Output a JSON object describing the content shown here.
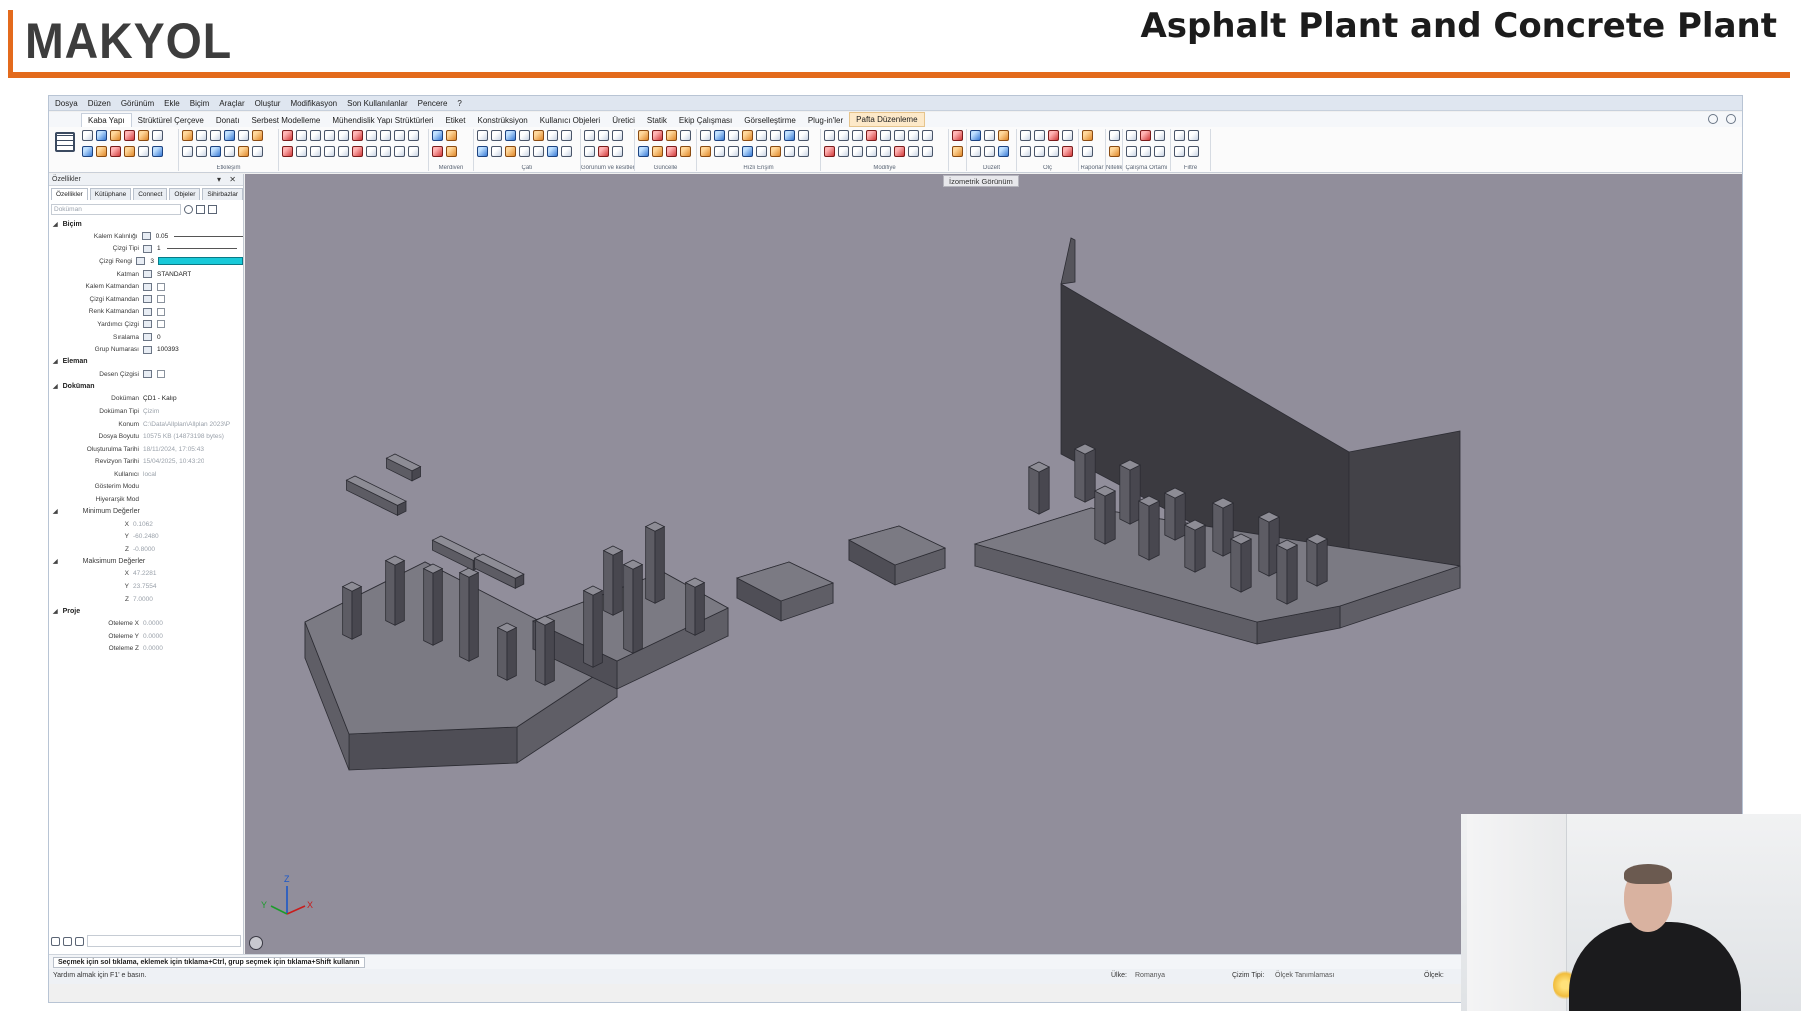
{
  "slide": {
    "logo_text": "MAKYOL",
    "title": "Asphalt Plant and Concrete Plant",
    "accent_color": "#e36a1c"
  },
  "menu": [
    "Dosya",
    "Düzen",
    "Görünüm",
    "Ekle",
    "Biçim",
    "Araçlar",
    "Oluştur",
    "Modifikasyon",
    "Son Kullanılanlar",
    "Pencere",
    "?"
  ],
  "tabs": [
    "Kaba Yapı",
    "Strüktürel Çerçeve",
    "Donatı",
    "Serbest Modelleme",
    "Mühendislik Yapı Strüktürleri",
    "Etiket",
    "Konstrüksiyon",
    "Kullanıcı Objeleri",
    "Üretici",
    "Statik",
    "Ekip Çalışması",
    "Görselleştirme",
    "Plug-in'ler",
    "Pafta Düzenleme"
  ],
  "ribbon_groups": [
    "Etkileşim",
    "Merdiven",
    "Çatı",
    "Görünüm ve kesitler",
    "Güncelle",
    "Hızlı Erişim",
    "Modifiye",
    "Düzelt",
    "Ölç",
    "Raporlar",
    "Nitelikler",
    "Filtre",
    "Çalışma Ortamı"
  ],
  "properties_panel": {
    "title": "Özellikler",
    "tabs": [
      "Özellikler",
      "Kütüphane",
      "Connect",
      "Objeler",
      "Sihirbazlar"
    ],
    "search_placeholder": "Doküman",
    "sections": {
      "bicim": "Biçim",
      "eleman": "Eleman",
      "dokuman": "Doküman",
      "proje": "Proje"
    },
    "bicim_rows": [
      {
        "key": "Kalem Kalınlığı",
        "value": "0.05"
      },
      {
        "key": "Çizgi Tipi",
        "value": "1"
      },
      {
        "key": "Çizgi Rengi",
        "value": "3"
      },
      {
        "key": "Katman",
        "value": "STANDART"
      },
      {
        "key": "Kalem Katmandan",
        "value": ""
      },
      {
        "key": "Çizgi Katmandan",
        "value": ""
      },
      {
        "key": "Renk Katmandan",
        "value": ""
      },
      {
        "key": "Yardımcı Çizgi",
        "value": ""
      },
      {
        "key": "Sıralama",
        "value": "0"
      },
      {
        "key": "Grup Numarası",
        "value": "100393"
      }
    ],
    "eleman_rows": [
      {
        "key": "Desen Çizgisi",
        "value": ""
      }
    ],
    "dokuman_rows": [
      {
        "key": "Doküman",
        "value": "ÇD1 - Kalıp"
      },
      {
        "key": "Doküman Tipi",
        "value": "Çizim"
      },
      {
        "key": "Konum",
        "value": "C:\\Data\\Allplan\\Allplan 2023\\P"
      },
      {
        "key": "Dosya Boyutu",
        "value": "10575 KB (14873198 bytes)"
      },
      {
        "key": "Oluşturulma Tarihi",
        "value": "18/11/2024, 17:05:43"
      },
      {
        "key": "Revizyon Tarihi",
        "value": "15/04/2025, 10:43:20"
      },
      {
        "key": "Kullanıcı",
        "value": "local"
      },
      {
        "key": "Gösterim Modu",
        "value": ""
      },
      {
        "key": "Hiyerarşik Mod",
        "value": ""
      }
    ],
    "min_label": "Minimum Değerler",
    "min_values": [
      {
        "key": "X",
        "value": "0.1062"
      },
      {
        "key": "Y",
        "value": "-60.2480"
      },
      {
        "key": "Z",
        "value": "-0.8000"
      }
    ],
    "max_label": "Maksimum Değerler",
    "max_values": [
      {
        "key": "X",
        "value": "47.2281"
      },
      {
        "key": "Y",
        "value": "23.7554"
      },
      {
        "key": "Z",
        "value": "7.0000"
      }
    ],
    "proje_rows": [
      {
        "key": "Öteleme X",
        "value": "0.0000"
      },
      {
        "key": "Öteleme Y",
        "value": "0.0000"
      },
      {
        "key": "Öteleme Z",
        "value": "0.0000"
      }
    ]
  },
  "viewport": {
    "view_label": "İzometrik Görünüm",
    "background": "#918e9b",
    "axis_labels": {
      "z": "Z",
      "x": "X",
      "y": "Y"
    }
  },
  "status": {
    "message": "Seçmek için sol tıklama, eklemek için tıklama+Ctrl, grup seçmek için tıklama+Shift kullanın",
    "help": "Yardım almak için F1' e basın.",
    "country_label": "Ülke:",
    "country_value": "Romanya",
    "drawing_type_label": "Çizim Tipi:",
    "drawing_type_value": "Ölçek Tanımlaması",
    "scale_label": "Ölçek:"
  }
}
